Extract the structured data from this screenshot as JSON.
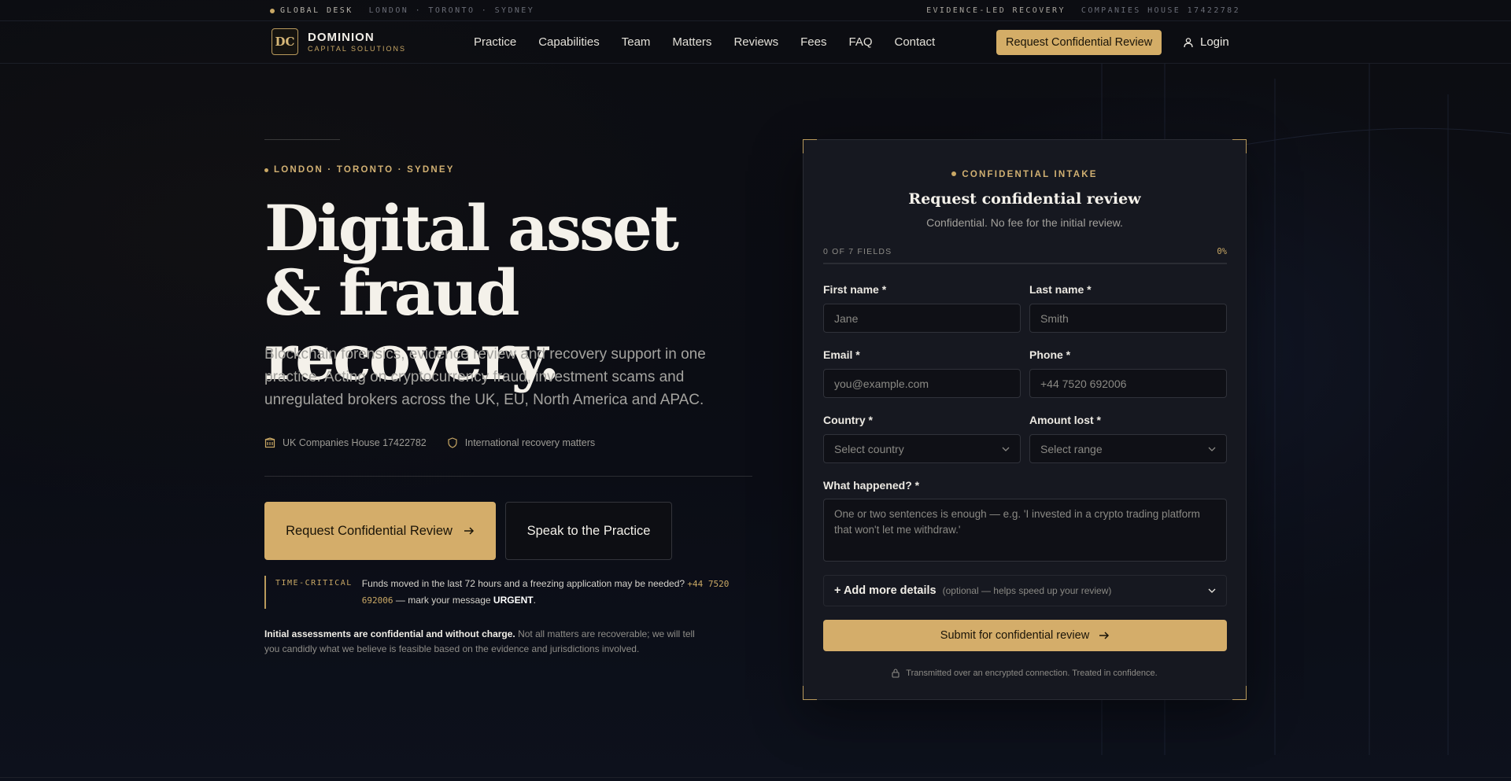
{
  "topbar": {
    "global_desk": "GLOBAL DESK",
    "locations": "LONDON · TORONTO · SYDNEY",
    "evidence": "EVIDENCE-LED RECOVERY",
    "companies_house": "COMPANIES HOUSE 17422782"
  },
  "brand": {
    "monogram": "DC",
    "name": "DOMINION",
    "tagline": "CAPITAL SOLUTIONS",
    "accent_color": "#d4ad6a"
  },
  "nav": {
    "items": [
      "Practice",
      "Capabilities",
      "Team",
      "Matters",
      "Reviews",
      "Fees",
      "FAQ",
      "Contact"
    ],
    "cta": "Request Confidential Review",
    "login": "Login"
  },
  "hero": {
    "eyebrow": "LONDON · TORONTO · SYDNEY",
    "headline_1": "Digital asset",
    "headline_2": "& fraud recovery.",
    "lede": "Blockchain forensics, evidence review and recovery support in one practice. Acting on cryptocurrency fraud, investment scams and unregulated brokers across the UK, EU, North America and APAC.",
    "badge_1": "UK Companies House 17422782",
    "badge_2": "International recovery matters",
    "primary_cta": "Request Confidential Review",
    "secondary_cta": "Speak to the Practice",
    "time_critical_label": "TIME-CRITICAL",
    "time_critical_pre": "Funds moved in the last 72 hours and a freezing application may be needed? ",
    "time_critical_phone": "+44 7520 692006",
    "time_critical_mid": " — mark your message ",
    "time_critical_urgent": "URGENT",
    "time_critical_end": ".",
    "assess_bold": "Initial assessments are confidential and without charge.",
    "assess_rest": " Not all matters are recoverable; we will tell you candidly what we believe is feasible based on the evidence and jurisdictions involved."
  },
  "form": {
    "eyebrow": "CONFIDENTIAL INTAKE",
    "title": "Request confidential review",
    "subtitle": "Confidential. No fee for the initial review.",
    "progress_label": "0 OF 7 FIELDS",
    "progress_pct": "0%",
    "progress_value": 0,
    "first_name_label": "First name *",
    "first_name_placeholder": "Jane",
    "last_name_label": "Last name *",
    "last_name_placeholder": "Smith",
    "email_label": "Email *",
    "email_placeholder": "you@example.com",
    "phone_label": "Phone *",
    "phone_placeholder": "+44 7520 692006",
    "country_label": "Country *",
    "country_value": "Select country",
    "amount_label": "Amount lost *",
    "amount_value": "Select range",
    "what_label": "What happened? *",
    "what_placeholder": "One or two sentences is enough — e.g. 'I invested in a crypto trading platform that won't let me withdraw.'",
    "more_label": "+ Add more details",
    "more_optional": "(optional — helps speed up your review)",
    "submit": "Submit for confidential review",
    "secure_note": "Transmitted over an encrypted connection. Treated in confidence."
  }
}
